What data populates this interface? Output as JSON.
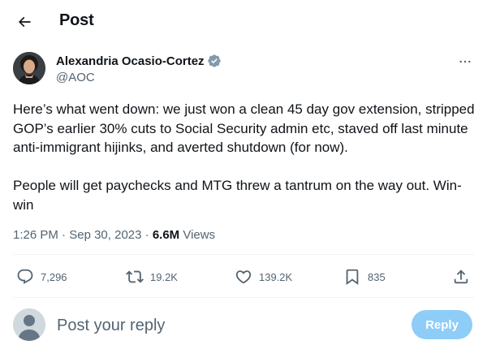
{
  "header": {
    "title": "Post",
    "back_icon": "arrow-left-icon"
  },
  "author": {
    "name": "Alexandria Ocasio-Cortez",
    "handle": "@AOC",
    "verified_icon": "verified-badge-icon",
    "verified_color": "#1d9bf0"
  },
  "tweet": {
    "paragraph1": "Here’s what went down: we just won a clean 45 day gov extension, stripped GOP’s earlier 30% cuts to Social Security admin etc, staved off last minute anti-immigrant hijinks, and averted shutdown (for now).",
    "paragraph2": "People will get paychecks and MTG threw a tantrum on the way out. Win-win"
  },
  "meta": {
    "time": "1:26 PM",
    "separator": " · ",
    "date": "Sep 30, 2023",
    "views_count": "6.6M",
    "views_label": "Views"
  },
  "actions": {
    "replies": "7,296",
    "reposts": "19.2K",
    "likes": "139.2K",
    "bookmarks": "835"
  },
  "reply": {
    "placeholder": "Post your reply",
    "button_label": "Reply",
    "button_color": "#8ecdf8"
  }
}
